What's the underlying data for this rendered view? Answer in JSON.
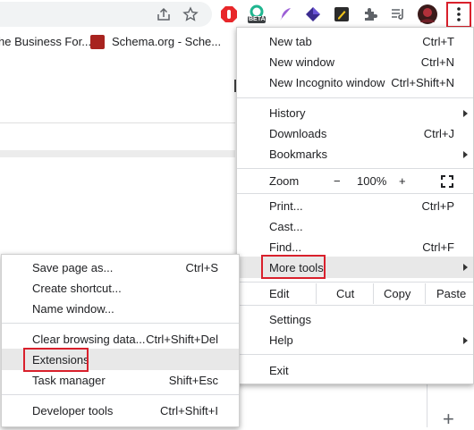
{
  "bookmarks": [
    {
      "label": "he Business For..."
    },
    {
      "icon": "schema-org-favicon",
      "label": "Schema.org - Sche..."
    }
  ],
  "toolbar": {
    "icons": [
      "share-icon",
      "star-icon",
      "adblock-extension-icon",
      "beta-extension-icon",
      "feather-extension-icon",
      "purple-cube-extension-icon",
      "pen-extension-icon",
      "puzzle-extensions-icon",
      "reading-list-icon",
      "profile-avatar",
      "more-menu-icon"
    ],
    "beta_badge": "BETA"
  },
  "main_menu": {
    "new_tab": {
      "label": "New tab",
      "shortcut": "Ctrl+T"
    },
    "new_window": {
      "label": "New window",
      "shortcut": "Ctrl+N"
    },
    "new_incognito": {
      "label": "New Incognito window",
      "shortcut": "Ctrl+Shift+N"
    },
    "history": {
      "label": "History"
    },
    "downloads": {
      "label": "Downloads",
      "shortcut": "Ctrl+J"
    },
    "bookmarks": {
      "label": "Bookmarks"
    },
    "zoom": {
      "label": "Zoom",
      "minus": "−",
      "value": "100%",
      "plus": "+"
    },
    "print": {
      "label": "Print...",
      "shortcut": "Ctrl+P"
    },
    "cast": {
      "label": "Cast..."
    },
    "find": {
      "label": "Find...",
      "shortcut": "Ctrl+F"
    },
    "more_tools": {
      "label": "More tools"
    },
    "edit": {
      "label": "Edit",
      "cut": "Cut",
      "copy": "Copy",
      "paste": "Paste"
    },
    "settings": {
      "label": "Settings"
    },
    "help": {
      "label": "Help"
    },
    "exit": {
      "label": "Exit"
    }
  },
  "sub_menu": {
    "save_page": {
      "label": "Save page as...",
      "shortcut": "Ctrl+S"
    },
    "create_shortcut": {
      "label": "Create shortcut..."
    },
    "name_window": {
      "label": "Name window..."
    },
    "clear_data": {
      "label": "Clear browsing data...",
      "shortcut": "Ctrl+Shift+Del"
    },
    "extensions": {
      "label": "Extensions"
    },
    "task_manager": {
      "label": "Task manager",
      "shortcut": "Shift+Esc"
    },
    "dev_tools": {
      "label": "Developer tools",
      "shortcut": "Ctrl+Shift+I"
    }
  },
  "colors": {
    "highlight_box": "#d9202c",
    "hover_bg": "#e8e8e8"
  },
  "page": {
    "plus_label": "+"
  }
}
